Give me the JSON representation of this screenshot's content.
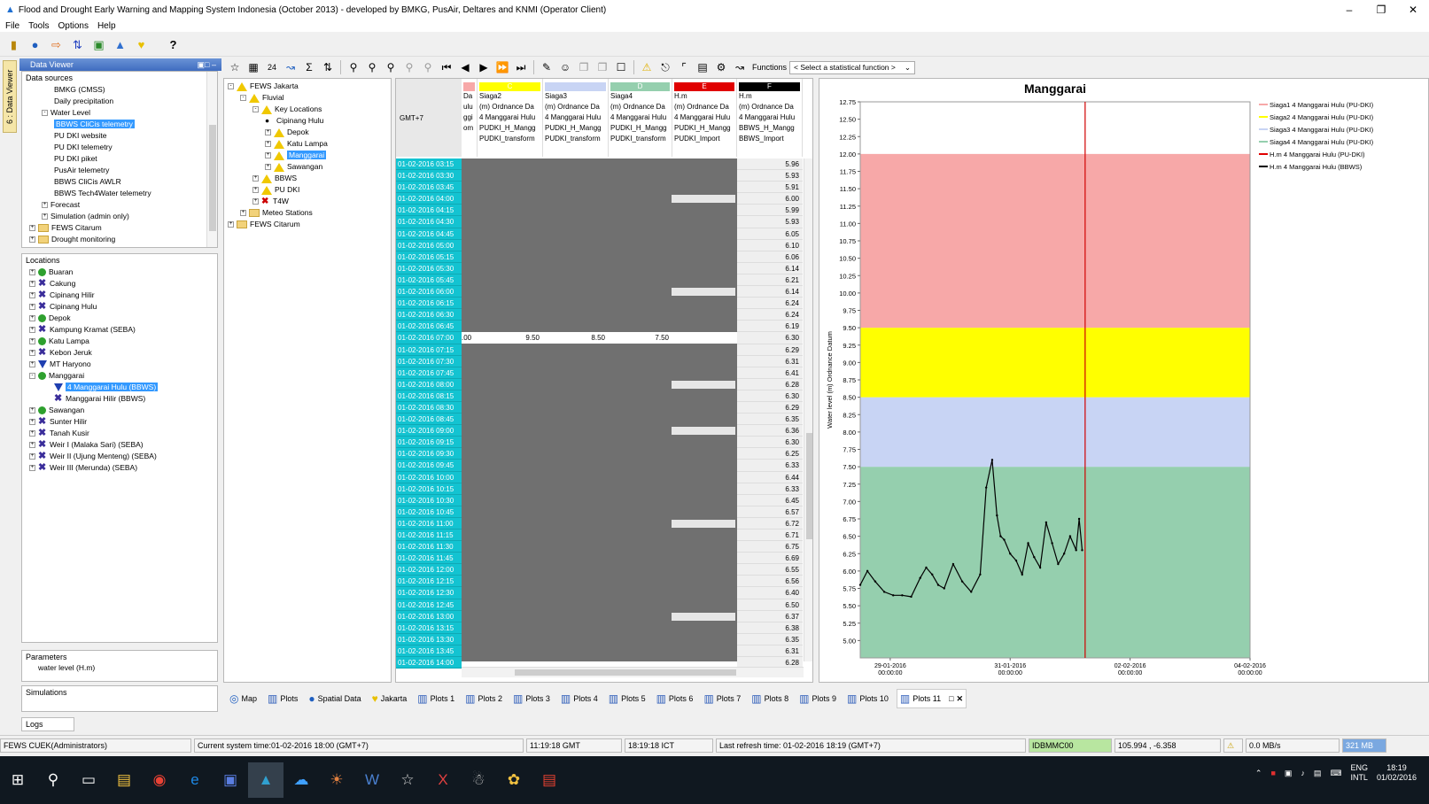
{
  "window": {
    "title": "Flood and Drought Early Warning and Mapping System Indonesia (October 2013) - developed by BMKG, PusAir, Deltares and KNMI  (Operator Client)",
    "controls": [
      "–",
      "❐",
      "✕"
    ]
  },
  "menu": [
    "File",
    "Tools",
    "Options",
    "Help"
  ],
  "side_tab": "6 : Data Viewer",
  "data_viewer": {
    "header": "Data Viewer",
    "data_sources_label": "Data sources",
    "data_sources": [
      {
        "label": "BMKG (CMSS)",
        "indent": 2,
        "icon": "none"
      },
      {
        "label": "Daily precipitation",
        "indent": 2,
        "icon": "none"
      },
      {
        "label": "Water Level",
        "indent": 1,
        "icon": "minus"
      },
      {
        "label": "BBWS CliCis telemetry",
        "indent": 2,
        "icon": "none",
        "selected": true
      },
      {
        "label": "PU DKI website",
        "indent": 2,
        "icon": "none"
      },
      {
        "label": "PU DKI telemetry",
        "indent": 2,
        "icon": "none"
      },
      {
        "label": "PU DKI piket",
        "indent": 2,
        "icon": "none"
      },
      {
        "label": "PusAir telemetry",
        "indent": 2,
        "icon": "none"
      },
      {
        "label": "BBWS CliCis AWLR",
        "indent": 2,
        "icon": "none"
      },
      {
        "label": "BBWS Tech4Water telemetry",
        "indent": 2,
        "icon": "none"
      },
      {
        "label": "Forecast",
        "indent": 1,
        "icon": "plus"
      },
      {
        "label": "Simulation (admin only)",
        "indent": 1,
        "icon": "plus"
      },
      {
        "label": "FEWS Citarum",
        "indent": 0,
        "icon": "folder"
      },
      {
        "label": "Drought monitoring",
        "indent": 0,
        "icon": "folder"
      }
    ],
    "locations_label": "Locations",
    "locations": [
      {
        "label": "Buaran",
        "icon": "dot",
        "indent": 0
      },
      {
        "label": "Cakung",
        "icon": "cross",
        "indent": 0
      },
      {
        "label": "Cipinang Hilir",
        "icon": "cross",
        "indent": 0
      },
      {
        "label": "Cipinang Hulu",
        "icon": "cross",
        "indent": 0
      },
      {
        "label": "Depok",
        "icon": "dot",
        "indent": 0
      },
      {
        "label": "Kampung Kramat (SEBA)",
        "icon": "cross",
        "indent": 0
      },
      {
        "label": "Katu Lampa",
        "icon": "dot",
        "indent": 0
      },
      {
        "label": "Kebon Jeruk",
        "icon": "cross",
        "indent": 0
      },
      {
        "label": "MT Haryono",
        "icon": "tri",
        "indent": 0
      },
      {
        "label": "Manggarai",
        "icon": "dot",
        "indent": 0
      },
      {
        "label": "4 Manggarai Hulu (BBWS)",
        "icon": "tri",
        "indent": 1,
        "selected": true
      },
      {
        "label": "Manggarai Hilir (BBWS)",
        "icon": "cross",
        "indent": 1
      },
      {
        "label": "Sawangan",
        "icon": "dot",
        "indent": 0
      },
      {
        "label": "Sunter Hilir",
        "icon": "cross",
        "indent": 0
      },
      {
        "label": "Tanah Kusir",
        "icon": "cross",
        "indent": 0
      },
      {
        "label": "Weir I (Malaka Sari) (SEBA)",
        "icon": "cross",
        "indent": 0
      },
      {
        "label": "Weir II (Ujung Menteng) (SEBA)",
        "icon": "cross",
        "indent": 0
      },
      {
        "label": "Weir III (Merunda) (SEBA)",
        "icon": "cross",
        "indent": 0
      }
    ],
    "parameters_label": "Parameters",
    "parameter": "water level (H.m)",
    "simulations_label": "Simulations",
    "logs_label": "Logs"
  },
  "toolbar": {
    "functions_label": "Functions",
    "statistical_select": "< Select a statistical function >",
    "hours_label": "24"
  },
  "fews_tree": [
    {
      "label": "FEWS Jakarta",
      "indent": 0,
      "icon": "warn"
    },
    {
      "label": "Fluvial",
      "indent": 1,
      "icon": "warn"
    },
    {
      "label": "Key Locations",
      "indent": 2,
      "icon": "warn"
    },
    {
      "label": "Cipinang Hulu",
      "indent": 3,
      "icon": "bullet"
    },
    {
      "label": "Depok",
      "indent": 3,
      "icon": "warn"
    },
    {
      "label": "Katu Lampa",
      "indent": 3,
      "icon": "warn"
    },
    {
      "label": "Manggarai",
      "indent": 3,
      "icon": "warn",
      "selected": true
    },
    {
      "label": "Sawangan",
      "indent": 3,
      "icon": "warn"
    },
    {
      "label": "BBWS",
      "indent": 2,
      "icon": "warn"
    },
    {
      "label": "PU DKI",
      "indent": 2,
      "icon": "warn"
    },
    {
      "label": "T4W",
      "indent": 2,
      "icon": "x"
    },
    {
      "label": "Meteo Stations",
      "indent": 1,
      "icon": "folder"
    },
    {
      "label": "FEWS Citarum",
      "indent": 0,
      "icon": "folder"
    }
  ],
  "table": {
    "timezone": "GMT+7",
    "columns": [
      {
        "flag": "",
        "color": "#f7a8a8",
        "line1": "",
        "line2": "Da",
        "line3": "ulu",
        "line4": "ggi",
        "line5": "om"
      },
      {
        "flag": "C",
        "color": "#ffff00",
        "line1": "Siaga2",
        "line2": "(m) Ordnance Da",
        "line3": "4 Manggarai Hulu",
        "line4": "PUDKI_H_Mangg",
        "line5": "PUDKI_transform"
      },
      {
        "flag": "",
        "color": "#c8d4f4",
        "line1": "Siaga3",
        "line2": "(m) Ordnance Da",
        "line3": "4 Manggarai Hulu",
        "line4": "PUDKI_H_Mangg",
        "line5": "PUDKI_transform"
      },
      {
        "flag": "D",
        "color": "#95cfae",
        "line1": "Siaga4",
        "line2": "(m) Ordnance Da",
        "line3": "4 Manggarai Hulu",
        "line4": "PUDKI_H_Mangg",
        "line5": "PUDKI_transform"
      },
      {
        "flag": "E",
        "color": "#e00000",
        "line1": "H.m",
        "line2": "(m) Ordnance Da",
        "line3": "4 Manggarai Hulu",
        "line4": "PUDKI_H_Mangg",
        "line5": "PUDKI_Import"
      },
      {
        "flag": "F",
        "color": "#000000",
        "line1": "H.m",
        "line2": "(m) Ordnance Da",
        "line3": "4 Manggarai Hulu",
        "line4": "BBWS_H_Mangg",
        "line5": "BBWS_Import"
      }
    ],
    "selected_row_values": [
      ".00",
      "9.50",
      "8.50",
      "7.50"
    ],
    "rows": [
      {
        "t": "01-02-2016 03:15",
        "v": "5.96"
      },
      {
        "t": "01-02-2016 03:30",
        "v": "5.93"
      },
      {
        "t": "01-02-2016 03:45",
        "v": "5.91"
      },
      {
        "t": "01-02-2016 04:00",
        "v": "6.00"
      },
      {
        "t": "01-02-2016 04:15",
        "v": "5.99"
      },
      {
        "t": "01-02-2016 04:30",
        "v": "5.93"
      },
      {
        "t": "01-02-2016 04:45",
        "v": "6.05"
      },
      {
        "t": "01-02-2016 05:00",
        "v": "6.10"
      },
      {
        "t": "01-02-2016 05:15",
        "v": "6.06"
      },
      {
        "t": "01-02-2016 05:30",
        "v": "6.14"
      },
      {
        "t": "01-02-2016 05:45",
        "v": "6.21"
      },
      {
        "t": "01-02-2016 06:00",
        "v": "6.14"
      },
      {
        "t": "01-02-2016 06:15",
        "v": "6.24"
      },
      {
        "t": "01-02-2016 06:30",
        "v": "6.24"
      },
      {
        "t": "01-02-2016 06:45",
        "v": "6.19"
      },
      {
        "t": "01-02-2016 07:00",
        "v": "6.30"
      },
      {
        "t": "01-02-2016 07:15",
        "v": "6.29"
      },
      {
        "t": "01-02-2016 07:30",
        "v": "6.31"
      },
      {
        "t": "01-02-2016 07:45",
        "v": "6.41"
      },
      {
        "t": "01-02-2016 08:00",
        "v": "6.28"
      },
      {
        "t": "01-02-2016 08:15",
        "v": "6.30"
      },
      {
        "t": "01-02-2016 08:30",
        "v": "6.29"
      },
      {
        "t": "01-02-2016 08:45",
        "v": "6.35"
      },
      {
        "t": "01-02-2016 09:00",
        "v": "6.36"
      },
      {
        "t": "01-02-2016 09:15",
        "v": "6.30"
      },
      {
        "t": "01-02-2016 09:30",
        "v": "6.25"
      },
      {
        "t": "01-02-2016 09:45",
        "v": "6.33"
      },
      {
        "t": "01-02-2016 10:00",
        "v": "6.44"
      },
      {
        "t": "01-02-2016 10:15",
        "v": "6.33"
      },
      {
        "t": "01-02-2016 10:30",
        "v": "6.45"
      },
      {
        "t": "01-02-2016 10:45",
        "v": "6.57"
      },
      {
        "t": "01-02-2016 11:00",
        "v": "6.72"
      },
      {
        "t": "01-02-2016 11:15",
        "v": "6.71"
      },
      {
        "t": "01-02-2016 11:30",
        "v": "6.75"
      },
      {
        "t": "01-02-2016 11:45",
        "v": "6.69"
      },
      {
        "t": "01-02-2016 12:00",
        "v": "6.55"
      },
      {
        "t": "01-02-2016 12:15",
        "v": "6.56"
      },
      {
        "t": "01-02-2016 12:30",
        "v": "6.40"
      },
      {
        "t": "01-02-2016 12:45",
        "v": "6.50"
      },
      {
        "t": "01-02-2016 13:00",
        "v": "6.37"
      },
      {
        "t": "01-02-2016 13:15",
        "v": "6.38"
      },
      {
        "t": "01-02-2016 13:30",
        "v": "6.35"
      },
      {
        "t": "01-02-2016 13:45",
        "v": "6.31"
      },
      {
        "t": "01-02-2016 14:00",
        "v": "6.28"
      }
    ]
  },
  "tabs": [
    "Map",
    "Plots",
    "Spatial Data",
    "Jakarta",
    "Plots 1",
    "Plots 2",
    "Plots 3",
    "Plots 4",
    "Plots 5",
    "Plots 6",
    "Plots 7",
    "Plots 8",
    "Plots 9",
    "Plots 10",
    "Plots 11"
  ],
  "status": {
    "user": "FEWS CUEK(Administrators)",
    "system_time": "Current system time:01-02-2016 18:00 (GMT+7)",
    "gmt": "11:19:18 GMT",
    "ict": "18:19:18 ICT",
    "refresh": "Last refresh time: 01-02-2016 18:19 (GMT+7)",
    "machine": "IDBMMC00",
    "coords": "105.994 , -6.358",
    "rate": "0.0 MB/s",
    "memory": "321 MB"
  },
  "taskbar": {
    "lang1": "ENG",
    "lang2": "INTL",
    "time": "18:19",
    "date": "01/02/2016"
  },
  "chart_data": {
    "type": "line",
    "title": "Manggarai",
    "ylabel": "Water level (m) Ordnance Datum",
    "ylim": [
      4.75,
      12.75
    ],
    "yticks": [
      "5.00",
      "5.25",
      "5.50",
      "5.75",
      "6.00",
      "6.25",
      "6.50",
      "6.75",
      "7.00",
      "7.25",
      "7.50",
      "7.75",
      "8.00",
      "8.25",
      "8.50",
      "8.75",
      "9.00",
      "9.25",
      "9.50",
      "9.75",
      "10.00",
      "10.25",
      "10.50",
      "10.75",
      "11.00",
      "11.25",
      "11.50",
      "11.75",
      "12.00",
      "12.25",
      "12.50",
      "12.75"
    ],
    "xlim_days": [
      0,
      6.5
    ],
    "xticks": [
      {
        "d": 0.5,
        "l1": "29-01-2016",
        "l2": "00:00:00"
      },
      {
        "d": 2.5,
        "l1": "31-01-2016",
        "l2": "00:00:00"
      },
      {
        "d": 4.5,
        "l1": "02-02-2016",
        "l2": "00:00:00"
      },
      {
        "d": 6.5,
        "l1": "04-02-2016",
        "l2": "00:00:00"
      }
    ],
    "now_day": 3.75,
    "bands": [
      {
        "from": 4.75,
        "to": 7.5,
        "color": "#95cfae"
      },
      {
        "from": 7.5,
        "to": 8.5,
        "color": "#c8d4f4"
      },
      {
        "from": 8.5,
        "to": 9.5,
        "color": "#ffff00"
      },
      {
        "from": 9.5,
        "to": 12.0,
        "color": "#f7a8a8"
      }
    ],
    "legend": [
      {
        "name": "Siaga1 4 Manggarai Hulu (PU-DKI)",
        "color": "#f7a8a8"
      },
      {
        "name": "Siaga2 4 Manggarai Hulu (PU-DKI)",
        "color": "#ffff00"
      },
      {
        "name": "Siaga3 4 Manggarai Hulu (PU-DKI)",
        "color": "#c8d4f4"
      },
      {
        "name": "Siaga4 4 Manggarai Hulu (PU-DKI)",
        "color": "#95cfae"
      },
      {
        "name": "H.m 4 Manggarai Hulu (PU-DKI)",
        "color": "#e00000"
      },
      {
        "name": "H.m 4 Manggarai Hulu (BBWS)",
        "color": "#000000"
      }
    ],
    "series": [
      {
        "name": "H.m 4 Manggarai Hulu (BBWS)",
        "color": "#000000",
        "x": [
          0.0,
          0.12,
          0.25,
          0.4,
          0.55,
          0.7,
          0.85,
          1.0,
          1.1,
          1.2,
          1.3,
          1.4,
          1.55,
          1.7,
          1.85,
          2.0,
          2.1,
          2.2,
          2.28,
          2.34,
          2.4,
          2.5,
          2.6,
          2.7,
          2.8,
          2.9,
          3.0,
          3.1,
          3.2,
          3.3,
          3.4,
          3.5,
          3.6,
          3.65,
          3.7
        ],
        "y": [
          5.8,
          6.0,
          5.85,
          5.7,
          5.65,
          5.65,
          5.63,
          5.9,
          6.05,
          5.95,
          5.8,
          5.75,
          6.1,
          5.85,
          5.7,
          5.95,
          7.2,
          7.6,
          6.8,
          6.5,
          6.45,
          6.25,
          6.15,
          5.95,
          6.4,
          6.2,
          6.05,
          6.7,
          6.4,
          6.1,
          6.25,
          6.5,
          6.3,
          6.75,
          6.3
        ]
      }
    ]
  }
}
